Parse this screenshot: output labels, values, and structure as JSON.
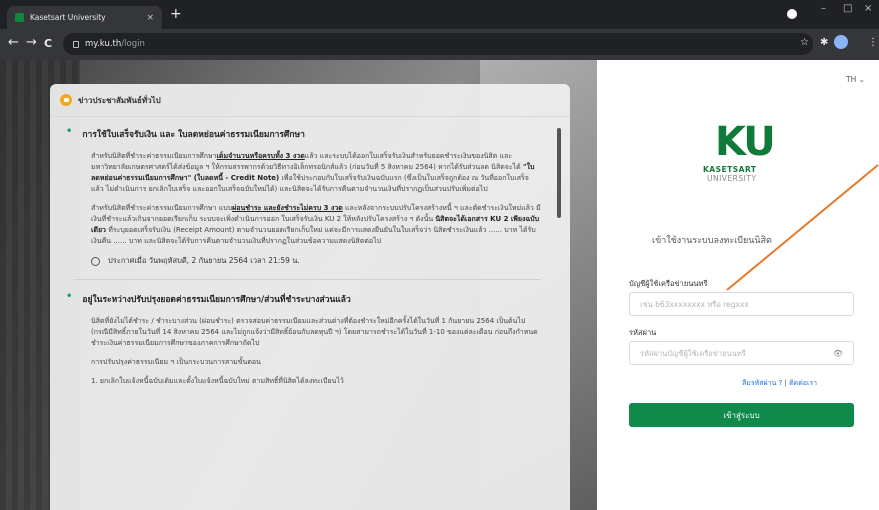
{
  "browser": {
    "tab_title": "Kasetsart University",
    "tab_close": "×",
    "new_tab": "+",
    "url_host": "my.ku.th",
    "url_path": "/login",
    "nav": {
      "back": "←",
      "forward": "→",
      "reload": "C"
    },
    "window": {
      "minimize": "–",
      "maximize": "□",
      "close": "×"
    },
    "toolbar_icons": {
      "star": "☆",
      "extensions": "✱",
      "menu": "⋮"
    }
  },
  "news": {
    "header": "ข่าวประชาสัมพันธ์ทั่วไป",
    "items": [
      {
        "title": "การใช้ใบเสร็จรับเงิน และ ใบลดหย่อนค่าธรรมเนียมการศึกษา",
        "p1_a": "สำหรับนิสิตที่ชำระค่าธรรมเนียมการศึกษา",
        "p1_u": "เต็มจำนวนหรือครบทั้ง 3 งวด",
        "p1_b": "แล้ว และระบบได้ออกใบเสร็จรับเงินสำหรับยอดชำระเงินของนิสิต และมหาวิทยาลัยเกษตรศาสตร์ได้ส่งข้อมูล ฯ ให้กรมสรรพากรด้วยวิธีทางอิเล็กทรอนิกส์แล้ว (ก่อนวันที่ 5 สิงหาคม 2564) หากได้รับส่วนลด นิสิตจะได้ ",
        "p1_bold": "\"ใบลดหย่อนค่าธรรมเนียมการศึกษา\" (ใบลดหนี้ - Credit Note)",
        "p1_c": " เพื่อใช้ประกอบกับใบเสร็จรับเงินฉบับแรก (ซึ่งเป็นใบเสร็จถูกต้อง ณ วันที่ออกใบเสร็จแล้ว ไม่ดำเนินการ ยกเลิกใบเสร็จ และออกใบเสร็จฉบับใหม่ได้) และนิสิตจะได้รับการคืนตามจำนวนเงินที่ปรากฏเป็นส่วนปรับเพิ่มต่อไป",
        "p2_a": "สำหรับนิสิตที่ชำระค่าธรรมเนียมการศึกษา แบบ",
        "p2_u": "ผ่อนชำระ และยังชำระไม่ครบ 3 งวด",
        "p2_b": " และหลังจากระบบปรับโครงสร้างหนี้ ฯ และตัดชำระเงินใหม่แล้ว มีเงินที่ชำระแล้วเกินจากยอดเรียกเก็บ ระบบจะเพิ่งดำเนินการออก ใบเสร็จรับเงิน KU 2 ให้หลังปรับโครงสร้าง ฯ ดังนั้น ",
        "p2_bold": "นิสิตจะได้เอกสาร KU 2 เพียงฉบับเดียว",
        "p2_c": " ที่ระบุยอดเสร็จรับเงิน (Receipt Amount) ตามจำนวนยอดเรียกเก็บใหม่ แต่จะมีการแสดงยืนยันในใบเสร็จว่า นิสิตชำระเงินแล้ว ...... บาท ได้รับเงินคืน ...... บาท และนิสิตจะได้รับการคืนตามจำนวนเงินที่ปรากฏในส่วนข้อความแสดงนิสิตต่อไป",
        "announced": "ประกาศเมื่อ วันพฤหัสบดี, 2 กันยายน 2564 เวลา 21:59 น."
      },
      {
        "title": "อยู่ในระหว่างปรับปรุงยอดค่าธรรมเนียมการศึกษา/ส่วนที่ชำระบางส่วนแล้ว",
        "p1": "นิสิตที่ยังไม่ได้ชำระ / ชำระบางส่วน (ผ่อนชำระ) ตรวจสอบค่าธรรมเนียมและส่วนต่างที่ต้องชำระใหม่อีกครั้งได้ในวันที่ 1 กันยายน 2564 เป็นต้นไป (กรณีมีสิทธิ์ภายในวันที่ 14 สิงหาคม 2564 และไม่ถูกแจ้งว่ามีสิทธิ์ย้อนกับลดทุนปี ฯ) โดยสามารถชำระได้ในวันที่ 1-10 ของแต่ละเดือน ก่อนถึงกำหนดชำระเงินค่าธรรมเนียมการศึกษาของภาคการศึกษาถัดไป",
        "p2": "การปรับปรุงค่าธรรมเนียม ฯ เป็นกระบวนการสามขั้นตอน",
        "p3": "1. ยกเลิกใบแจ้งหนี้ฉบับเดิมและตั้งใบแจ้งหนี้ฉบับใหม่ ตามสิทธิ์ที่นิสิตได้ลงทะเบียนไว้"
      }
    ]
  },
  "login": {
    "lang": "TH ⌄",
    "logo_main": "KU",
    "logo_line1": "KASETSART",
    "logo_line2": "UNIVERSITY",
    "title": "เข้าใช้งานระบบลงทะเบียนนิสิต",
    "username_label": "บัญชีผู้ใช้เครือข่ายนนทรี",
    "username_placeholder": "เช่น b63xxxxxxxx หรือ regxxx",
    "password_label": "รหัสผ่าน",
    "password_placeholder": "รหัสผ่านบัญชีผู้ใช้เครือข่ายนนทรี",
    "eye_icon": "👁",
    "forgot": "ลืมรหัสผ่าน ?",
    "separator": "|",
    "contact": "ติดต่อเรา",
    "submit": "เข้าสู่ระบบ"
  },
  "colors": {
    "accent": "#0f8a4a",
    "brand": "#0f7a3a",
    "annotation": "#e8782a"
  }
}
